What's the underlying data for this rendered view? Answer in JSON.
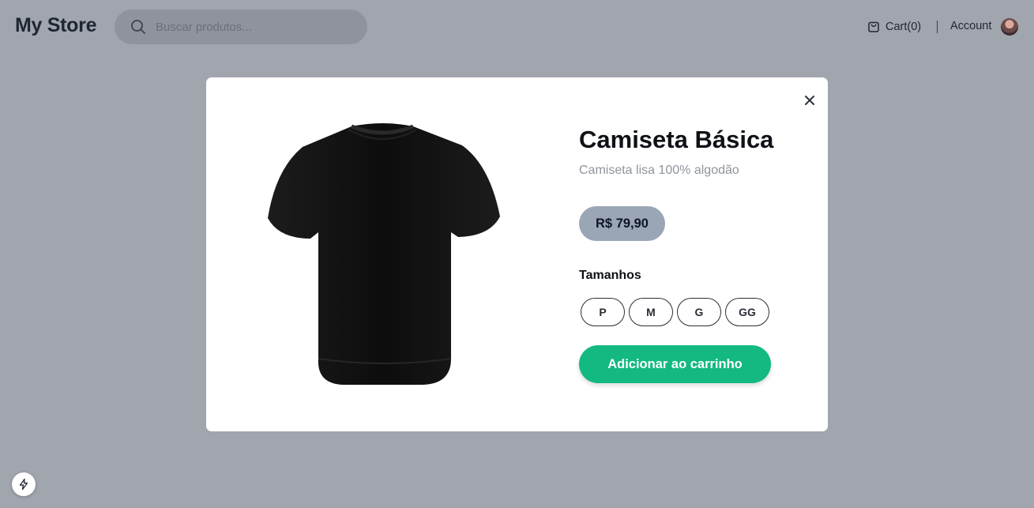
{
  "header": {
    "logo": "My Store",
    "search": {
      "placeholder": "Buscar produtos...",
      "icon": "search-icon"
    },
    "cart_label": "Cart(0)",
    "cart_icon": "shopping-bag-icon",
    "account_label": "Account"
  },
  "modal": {
    "product": {
      "name": "Camiseta Básica",
      "description": "Camiseta lisa 100% algodão",
      "price": "R$ 79,90",
      "image_icon": "t-shirt-image",
      "color": "#111111"
    },
    "sizes_label": "Tamanhos",
    "sizes": [
      "P",
      "M",
      "G",
      "GG"
    ],
    "add_to_cart_label": "Adicionar ao carrinho",
    "close_icon": "close-icon"
  },
  "colors": {
    "overlay": "#a1a5ad",
    "accent": "#13b981",
    "price_badge": "#9aa6b6"
  }
}
